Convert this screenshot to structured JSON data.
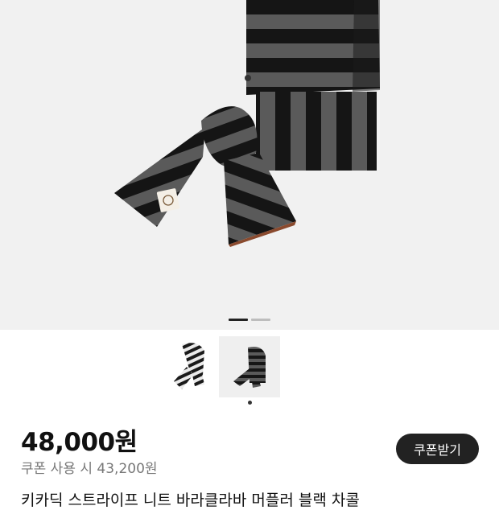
{
  "product": {
    "price": "48,000원",
    "coupon_price_text": "쿠폰 사용 시 43,200원",
    "coupon_button_label": "쿠폰받기",
    "title": "키카딕 스트라이프 니트 바라클라바 머플러 블랙 차콜"
  },
  "gallery": {
    "image_count": 2,
    "current_index": 1,
    "thumbnails": [
      {
        "name": "hooded-scarf-front-thumbnail",
        "selected": false
      },
      {
        "name": "hooded-scarf-side-thumbnail",
        "selected": true
      }
    ]
  },
  "colors": {
    "stripe_black": "#151515",
    "stripe_gray": "#5a5a5a",
    "button_bg": "#222222",
    "hero_bg": "#f1f1f1"
  }
}
